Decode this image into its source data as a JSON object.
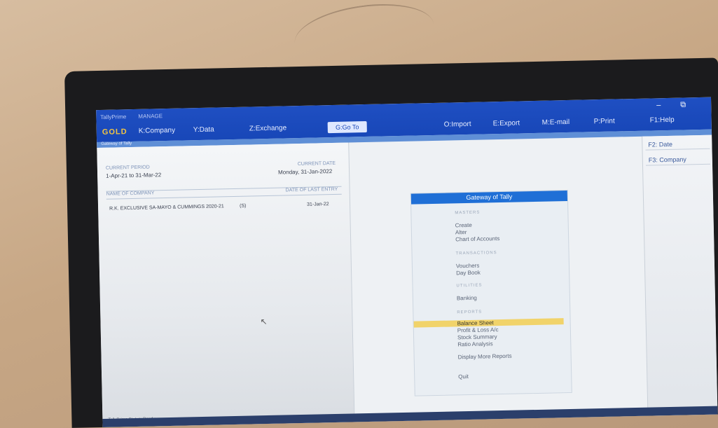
{
  "topbar": {
    "brand_line1": "TallyPrime",
    "brand_line2": "MANAGE",
    "brand": "GOLD",
    "menu": [
      {
        "key": "company",
        "label": "K:Company"
      },
      {
        "key": "data",
        "label": "Y:Data"
      },
      {
        "key": "exchange",
        "label": "Z:Exchange"
      },
      {
        "key": "import",
        "label": "O:Import"
      },
      {
        "key": "export",
        "label": "E:Export"
      },
      {
        "key": "email",
        "label": "M:E-mail"
      },
      {
        "key": "print",
        "label": "P:Print"
      },
      {
        "key": "help",
        "label": "F1:Help"
      }
    ],
    "goto": "G:Go To",
    "minimize": "–",
    "restore": "⧉"
  },
  "subbar_text": "Gateway of Tally",
  "left_panel": {
    "current_period_label": "CURRENT PERIOD",
    "current_period": "1-Apr-21 to 31-Mar-22",
    "current_date_label": "CURRENT DATE",
    "current_date": "Monday, 31-Jan-2022",
    "company_label": "NAME OF COMPANY",
    "last_entry_label": "DATE OF LAST ENTRY",
    "company_name": "R.K. EXCLUSIVE SA-MAYO & CUMMINGS 2020-21",
    "company_code": "(S)",
    "last_entry_date": "31-Jan-22",
    "status": "TallyPrime Status: Ready"
  },
  "gateway": {
    "title": "Gateway of Tally",
    "masters_head": "MASTERS",
    "create": "Create",
    "alter": "Alter",
    "chart": "Chart of Accounts",
    "transactions_head": "TRANSACTIONS",
    "vouchers": "Vouchers",
    "day_book": "Day Book",
    "utilities_head": "UTILITIES",
    "banking": "Banking",
    "reports_head": "REPORTS",
    "balance_sheet": "Balance Sheet",
    "profit_loss": "Profit & Loss A/c",
    "stock_summary": "Stock Summary",
    "ratio_analysis": "Ratio Analysis",
    "display_more": "Display More Reports",
    "quit": "Quit"
  },
  "right_panel": {
    "date_btn": "F2: Date",
    "company_btn": "F3: Company"
  },
  "colors": {
    "topbar": "#1847b8",
    "brand": "#f3c542",
    "highlight": "#f1d36a",
    "gateway_title": "#1f6fd6"
  }
}
